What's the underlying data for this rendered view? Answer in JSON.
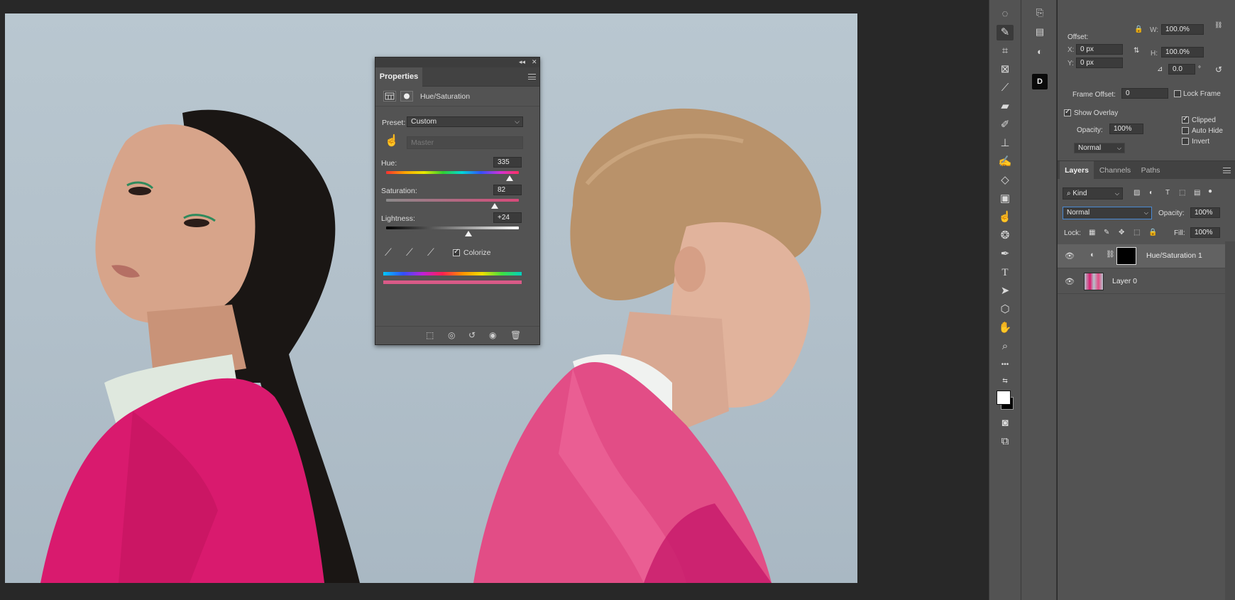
{
  "properties": {
    "tab_label": "Properties",
    "collapse_glyph": "◂◂",
    "close_glyph": "✕",
    "adjustment_name": "Hue/Saturation",
    "preset_label": "Preset:",
    "preset_value": "Custom",
    "channel_value": "Master",
    "hue_label": "Hue:",
    "hue_value": "335",
    "hue_level": 0.93,
    "saturation_label": "Saturation:",
    "saturation_value": "82",
    "saturation_level": 0.82,
    "lightness_label": "Lightness:",
    "lightness_value": "+24",
    "lightness_level": 0.62,
    "colorize_label": "Colorize",
    "colorize_checked": true,
    "tint_color": "#d95a87"
  },
  "tools": {
    "icons": [
      "lasso-icon",
      "quick-selection-icon",
      "crop-icon",
      "frame-icon",
      "eyedropper-icon",
      "healing-brush-icon",
      "brush-icon",
      "clone-stamp-icon",
      "history-brush-icon",
      "eraser-icon",
      "gradient-icon",
      "smudge-icon",
      "blur-icon",
      "pen-icon",
      "type-icon",
      "path-selection-icon",
      "shape-icon",
      "hand-icon",
      "zoom-icon",
      "more-tools-icon"
    ],
    "type_glyph": "T",
    "more_glyph": "•••"
  },
  "strip2": {
    "black_badge": "D"
  },
  "offset_panel": {
    "w_label": "W:",
    "w_value": "100.0%",
    "h_label": "H:",
    "h_value": "100.0%",
    "offset_label": "Offset:",
    "x_label": "X:",
    "x_value": "0 px",
    "y_label": "Y:",
    "y_value": "0 px",
    "angle_value": "0.0",
    "degree_glyph": "°",
    "frame_offset_label": "Frame Offset:",
    "frame_offset_value": "0",
    "lock_frame_label": "Lock Frame",
    "show_overlay_label": "Show Overlay",
    "opacity_label": "Opacity:",
    "opacity_value": "100%",
    "blend_value": "Normal",
    "clipped_label": "Clipped",
    "auto_hide_label": "Auto Hide",
    "invert_label": "Invert"
  },
  "layers": {
    "tabs": [
      "Layers",
      "Channels",
      "Paths"
    ],
    "kind_label": "Kind",
    "blend_mode": "Normal",
    "opacity_label": "Opacity:",
    "opacity_value": "100%",
    "lock_label": "Lock:",
    "fill_label": "Fill:",
    "fill_value": "100%",
    "items": [
      {
        "name": "Hue/Saturation 1"
      },
      {
        "name": "Layer 0"
      }
    ]
  },
  "colors": {
    "accent": "#4a8ad4",
    "magenta_coat": "#d91a6e",
    "background_sky": "#b5c3cc"
  }
}
